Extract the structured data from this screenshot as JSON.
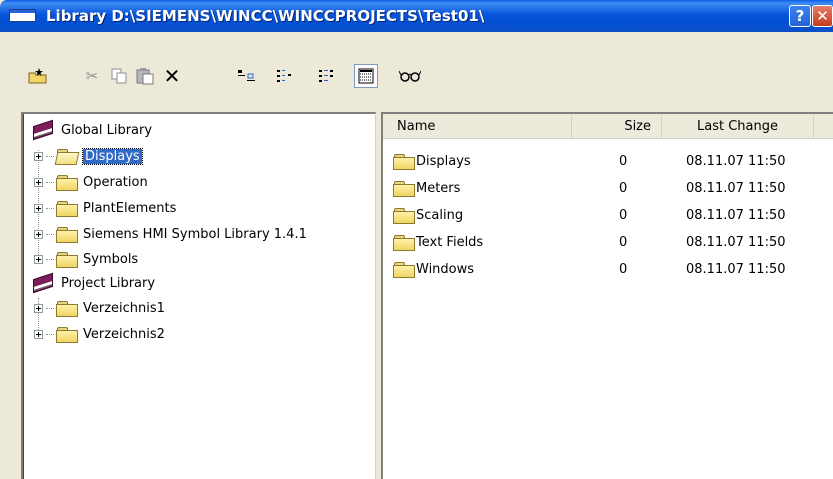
{
  "window": {
    "title": "Library  D:\\SIEMENS\\WINCC\\WINCCPROJECTS\\Test01\\",
    "help_label": "?",
    "close_label": "✕"
  },
  "toolbar": {
    "buttons": [
      {
        "name": "new-folder-icon",
        "glyph": "📁"
      },
      {
        "name": "cut-icon",
        "glyph": "✂"
      },
      {
        "name": "copy-icon",
        "glyph": "⧉"
      },
      {
        "name": "paste-icon",
        "glyph": "📋"
      },
      {
        "name": "delete-icon",
        "glyph": "✕"
      },
      {
        "name": "large-icons-icon",
        "glyph": "⊏"
      },
      {
        "name": "small-icons-icon",
        "glyph": "⋮"
      },
      {
        "name": "list-view-icon",
        "glyph": "☰"
      },
      {
        "name": "details-view-icon",
        "glyph": "▦"
      },
      {
        "name": "preview-icon",
        "glyph": "👓"
      }
    ]
  },
  "tree": {
    "global_library": "Global Library",
    "global_items": [
      "Displays",
      "Operation",
      "PlantElements",
      "Siemens HMI Symbol Library 1.4.1",
      "Symbols"
    ],
    "project_library": "Project Library",
    "project_items": [
      "Verzeichnis1",
      "Verzeichnis2"
    ]
  },
  "list": {
    "columns": [
      "Name",
      "Size",
      "Last Change"
    ],
    "rows": [
      {
        "name": "Displays",
        "size": "0",
        "last_change": "08.11.07 11:50"
      },
      {
        "name": "Meters",
        "size": "0",
        "last_change": "08.11.07 11:50"
      },
      {
        "name": "Scaling",
        "size": "0",
        "last_change": "08.11.07 11:50"
      },
      {
        "name": "Text Fields",
        "size": "0",
        "last_change": "08.11.07 11:50"
      },
      {
        "name": "Windows",
        "size": "0",
        "last_change": "08.11.07 11:50"
      }
    ]
  },
  "colors": {
    "titlebar": "#0A5EE8",
    "selection": "#316AC5",
    "face": "#ECE9D8"
  }
}
